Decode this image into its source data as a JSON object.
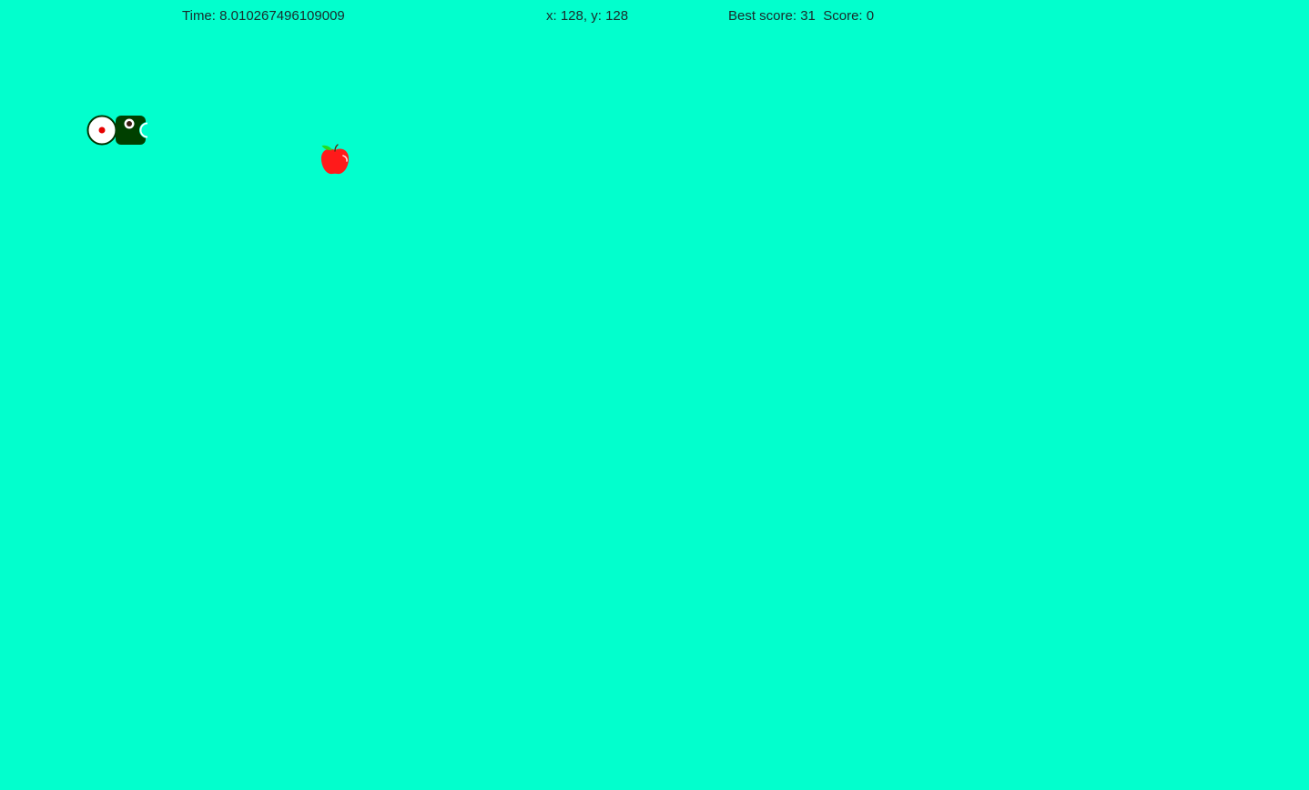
{
  "hud": {
    "time_label": "Time:",
    "time_value": "8.010267496109009",
    "x_label": "x:",
    "x_value": "128",
    "y_label": "y:",
    "y_value": "128",
    "best_label": "Best score:",
    "best_value": "31",
    "score_label": "Score:",
    "score_value": "0"
  },
  "colors": {
    "board_background": "#02ffcd",
    "snake_head": "#004000",
    "snake_tail_fill": "#ffffff",
    "snake_tail_dot": "#e60000",
    "apple_red": "#ff1a1a",
    "apple_leaf": "#22dd22",
    "hud_text": "#1a2b2b"
  },
  "sprites": {
    "snake_head_icon": "snake-head-icon",
    "snake_tail_icon": "snake-tail-icon",
    "apple_icon": "apple-icon"
  }
}
